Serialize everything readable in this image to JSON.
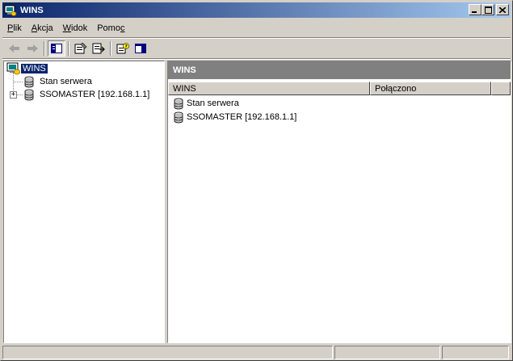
{
  "window": {
    "title": "WINS"
  },
  "caption_buttons": {
    "minimize": "_",
    "maximize": "□",
    "close": "×"
  },
  "menu": [
    {
      "label": "Plik",
      "underline": "P",
      "rest": "lik"
    },
    {
      "label": "Akcja",
      "underline": "A",
      "rest": "kcja"
    },
    {
      "label": "Widok",
      "underline": "W",
      "rest": "idok"
    },
    {
      "label": "Pomoc",
      "pre": "Pomo",
      "underline": "c"
    }
  ],
  "toolbar": {
    "buttons": [
      "back-arrow-icon",
      "forward-arrow-icon",
      "show-hide-console-tree-icon",
      "properties-icon",
      "export-list-icon",
      "help-icon",
      "show-hide-action-pane-icon"
    ]
  },
  "tree": {
    "root": {
      "label": "WINS",
      "selected": true
    },
    "children": [
      {
        "label": "Stan serwera",
        "expandable": false
      },
      {
        "label": "SSOMASTER [192.168.1.1]",
        "expandable": true,
        "expander": "+"
      }
    ]
  },
  "right_pane": {
    "header": "WINS",
    "columns": [
      "WINS",
      "Połączono"
    ],
    "rows": [
      {
        "name": "Stan serwera",
        "connected": ""
      },
      {
        "name": "SSOMASTER [192.168.1.1]",
        "connected": ""
      }
    ]
  },
  "statusbar": {
    "cells": [
      "",
      "",
      ""
    ]
  },
  "colors": {
    "titlebar_start": "#0a246a",
    "titlebar_end": "#a6caf0",
    "selection": "#0a246a",
    "pane_header": "#808080",
    "face": "#d4d0c8"
  }
}
